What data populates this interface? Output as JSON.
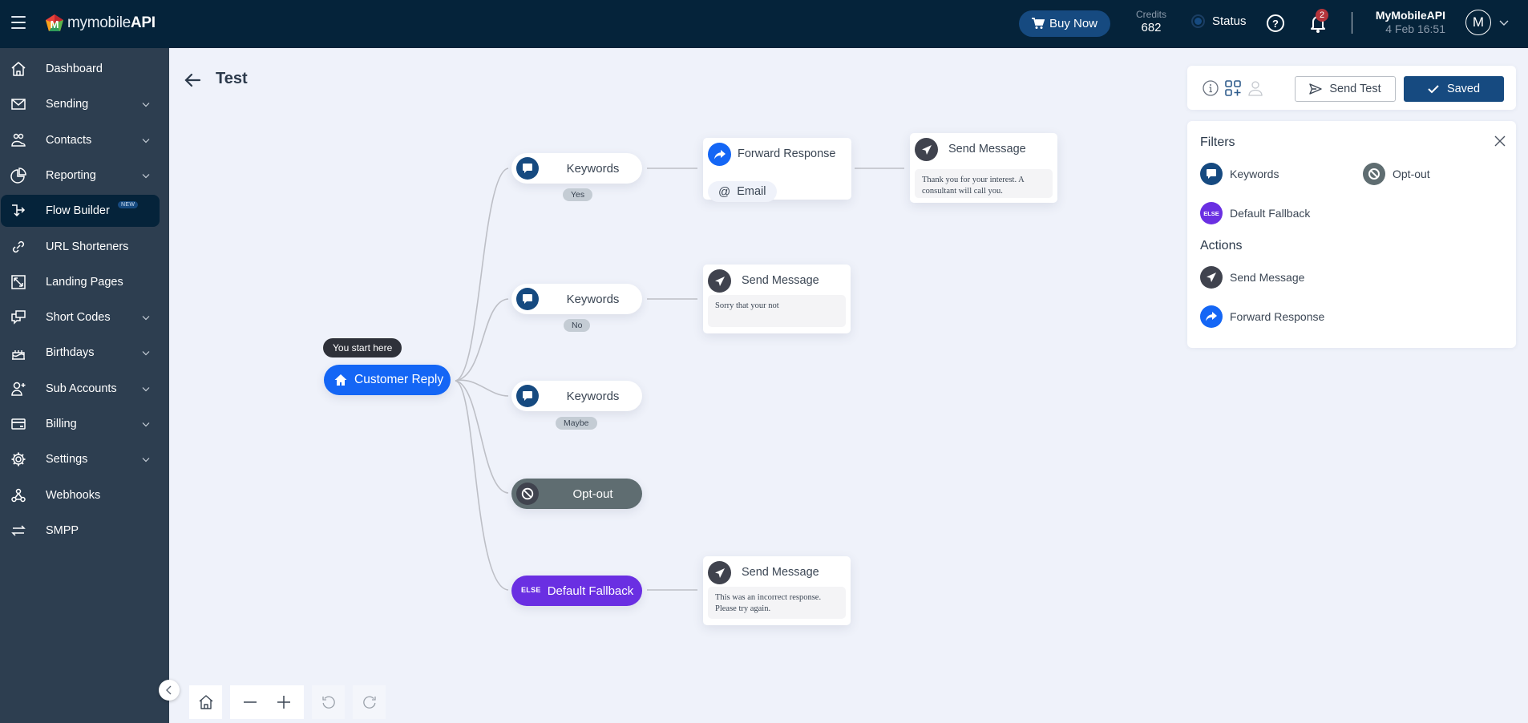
{
  "header": {
    "menu_icon": "hamburger-icon",
    "logo_text_light": "mymobile",
    "logo_text_bold": "API",
    "buy_now_label": "Buy Now",
    "credits_label": "Credits",
    "credits_value": "682",
    "status_label": "Status",
    "notification_count": "2",
    "user_name": "MyMobileAPI",
    "user_datetime": "4 Feb 16:51",
    "avatar_initial": "M"
  },
  "sidebar": {
    "items": [
      {
        "label": "Dashboard",
        "icon": "home-icon",
        "expandable": false
      },
      {
        "label": "Sending",
        "icon": "envelope-icon",
        "expandable": true
      },
      {
        "label": "Contacts",
        "icon": "contacts-icon",
        "expandable": true
      },
      {
        "label": "Reporting",
        "icon": "pie-chart-icon",
        "expandable": true
      },
      {
        "label": "Flow Builder",
        "icon": "flow-icon",
        "expandable": false,
        "active": true,
        "badge": "NEW"
      },
      {
        "label": "URL Shorteners",
        "icon": "link-icon",
        "expandable": false
      },
      {
        "label": "Landing Pages",
        "icon": "expand-icon",
        "expandable": false
      },
      {
        "label": "Short Codes",
        "icon": "chat-boxes-icon",
        "expandable": true
      },
      {
        "label": "Birthdays",
        "icon": "cake-icon",
        "expandable": true
      },
      {
        "label": "Sub Accounts",
        "icon": "user-plus-icon",
        "expandable": true
      },
      {
        "label": "Billing",
        "icon": "credit-card-icon",
        "expandable": true
      },
      {
        "label": "Settings",
        "icon": "gear-icon",
        "expandable": true
      },
      {
        "label": "Webhooks",
        "icon": "webhook-icon",
        "expandable": false
      },
      {
        "label": "SMPP",
        "icon": "arrows-swap-icon",
        "expandable": false
      }
    ]
  },
  "page": {
    "title": "Test"
  },
  "flow": {
    "start_tooltip": "You start here",
    "start_node": "Customer Reply",
    "filters": [
      {
        "type": "keywords",
        "label": "Keywords",
        "tag": "Yes"
      },
      {
        "type": "keywords",
        "label": "Keywords",
        "tag": "No"
      },
      {
        "type": "keywords",
        "label": "Keywords",
        "tag": "Maybe"
      },
      {
        "type": "optout",
        "label": "Opt-out"
      },
      {
        "type": "fallback",
        "label": "Default Fallback",
        "prefix": "ELSE"
      }
    ],
    "actions": {
      "forward": {
        "title": "Forward Response",
        "chip": "Email"
      },
      "yes_message": {
        "title": "Send Message",
        "text": "Thank you for your interest. A consultant will call you."
      },
      "no_message": {
        "title": "Send Message",
        "text": "Sorry that your not"
      },
      "fallback_message": {
        "title": "Send Message",
        "text": "This was an incorrect response. Please try again."
      }
    }
  },
  "toolbar": {
    "send_test_label": "Send Test",
    "saved_label": "Saved"
  },
  "palette": {
    "filters_heading": "Filters",
    "filters": [
      {
        "label": "Keywords",
        "icon": "chat-bubble-icon"
      },
      {
        "label": "Opt-out",
        "icon": "block-icon"
      },
      {
        "label": "Default Fallback",
        "icon": "else-icon",
        "prefix": "ELSE"
      }
    ],
    "actions_heading": "Actions",
    "actions": [
      {
        "label": "Send Message",
        "icon": "paper-plane-icon"
      },
      {
        "label": "Forward Response",
        "icon": "forward-icon"
      }
    ]
  },
  "colors": {
    "topbar": "#05233a",
    "sidebar": "#2d3e50",
    "canvas": "#eff2fa",
    "primary": "#164a80",
    "start_node": "#1466f5",
    "fallback": "#6a2fe2",
    "optout": "#5f6d71"
  }
}
